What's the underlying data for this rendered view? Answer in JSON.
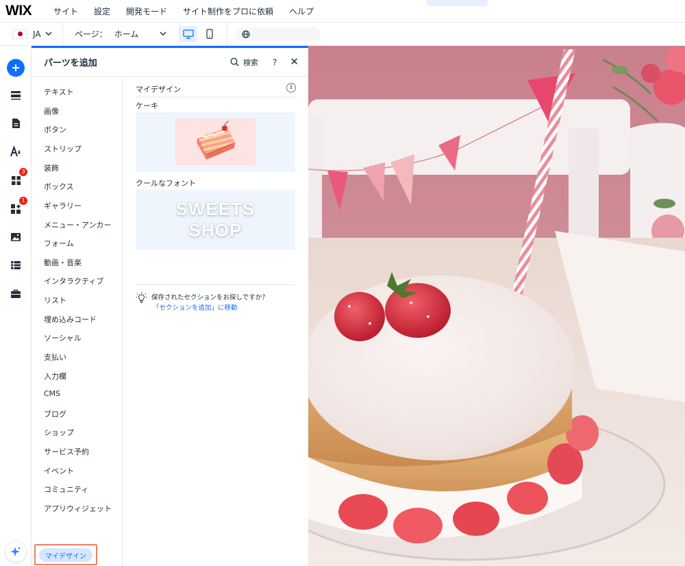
{
  "app": {
    "logo": "WIX"
  },
  "topmenu": [
    "サイト",
    "設定",
    "開発モード",
    "サイト制作をプロに依頼",
    "ヘルプ"
  ],
  "collapse_glyph": "ˆ",
  "subbar": {
    "lang_code": "JA",
    "page_label": "ページ：",
    "page_value": "ホーム",
    "device_active": "desktop"
  },
  "rail": {
    "icons": [
      "add-icon",
      "sections-icon",
      "pages-icon",
      "theme-icon",
      "apps-icon",
      "business-icon",
      "media-icon",
      "cms-icon",
      "portfolio-icon",
      "ai-assistant-icon"
    ],
    "badges": {
      "apps": "3",
      "business": "1"
    }
  },
  "panel": {
    "title": "パーツを追加",
    "search_label": "検索",
    "help_label": "?",
    "close_label": "✕",
    "categories": [
      "テキスト",
      "画像",
      "ボタン",
      "ストリップ",
      "装飾",
      "ボックス",
      "ギャラリー",
      "メニュー・アンカー",
      "フォーム",
      "動画・音楽",
      "インタラクティブ",
      "リスト",
      "埋め込みコード",
      "ソーシャル",
      "支払い",
      "入力欄",
      "CMS",
      "ブログ",
      "ショップ",
      "サービス予約",
      "イベント",
      "コミュニティ",
      "アプリウィジェット"
    ],
    "active_category": "マイデザイン",
    "section_title": "マイデザイン",
    "items": [
      {
        "label": "ケーキ"
      },
      {
        "label": "クールなフォント",
        "preview_line1": "SWEETS",
        "preview_line2": "SHOP"
      }
    ],
    "hint_text": "保存されたセクションをお探しですか？",
    "hint_link": "「セクションを追加」に移動"
  },
  "colors": {
    "accent": "#116dff",
    "highlight_outline": "#f2805f",
    "badge": "#e62214"
  }
}
